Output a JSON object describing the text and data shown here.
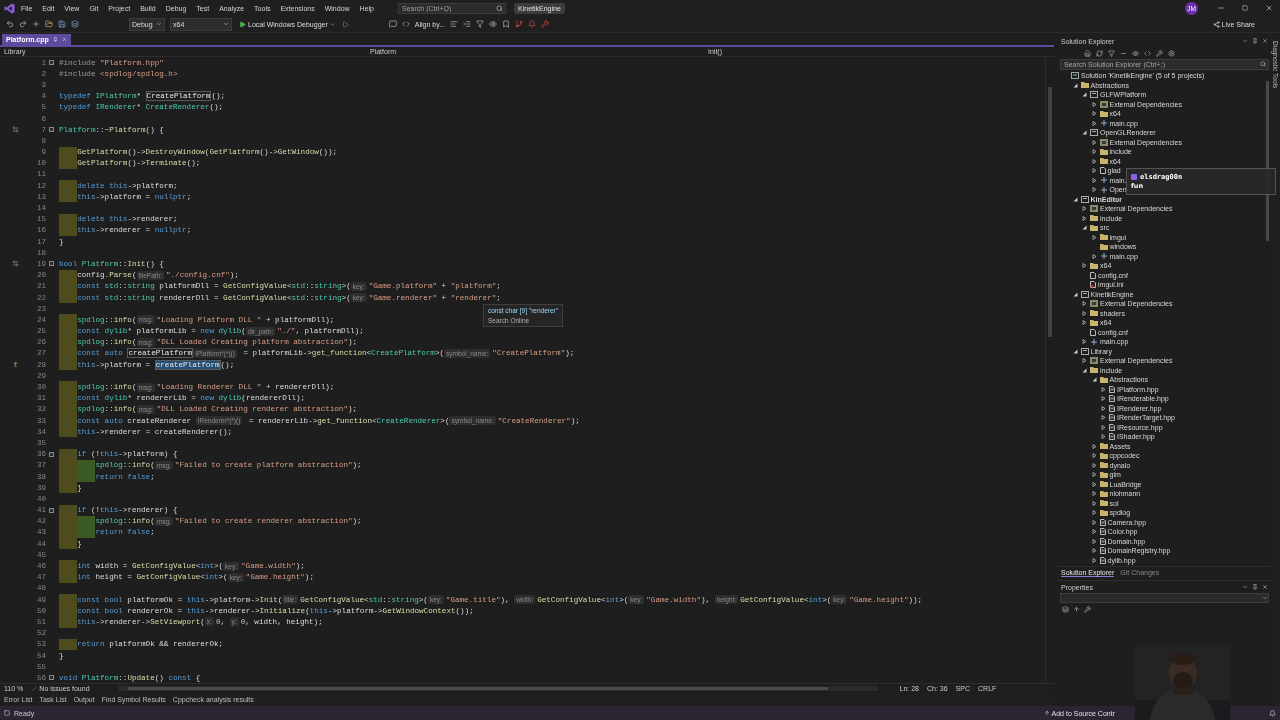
{
  "title_bar": {
    "menus": [
      "File",
      "Edit",
      "View",
      "Git",
      "Project",
      "Build",
      "Debug",
      "Test",
      "Analyze",
      "Tools",
      "Extensions",
      "Window",
      "Help"
    ],
    "search": {
      "placeholder": "Search (Ctrl+Q)"
    },
    "project": "KinetikEngine",
    "avatar": "JM"
  },
  "toolbar": {
    "configuration": "Debug",
    "platform": "x64",
    "debugger": "Local Windows Debugger",
    "align": "Align by...",
    "live_share": "Live Share"
  },
  "editor": {
    "tabs": [
      {
        "label": "Platform.cpp",
        "selected": true
      }
    ],
    "nav": {
      "project": "Library",
      "scope": "Platform",
      "member": "Init()"
    },
    "lines": [
      {
        "no": "1",
        "fold": true,
        "mark": false,
        "tokens": [
          {
            "kind": "pp",
            "text": "#include "
          },
          {
            "kind": "str",
            "text": "\"Platform.hpp\""
          }
        ]
      },
      {
        "no": "2",
        "fold": false,
        "mark": false,
        "tokens": [
          {
            "kind": "pp",
            "text": "#include "
          },
          {
            "kind": "str",
            "text": "<spdlog/spdlog.h>"
          }
        ]
      },
      {
        "no": "3",
        "fold": false,
        "mark": false
      },
      {
        "no": "4",
        "fold": false,
        "mark": false,
        "tokens": [
          {
            "kind": "kw",
            "text": "typedef "
          },
          {
            "kind": "ty",
            "text": "IPlatform"
          },
          {
            "kind": "txt",
            "text": "* "
          },
          {
            "kind": "ref",
            "text": "CreatePlatform"
          },
          {
            "kind": "txt",
            "text": "();"
          }
        ]
      },
      {
        "no": "5",
        "fold": false,
        "mark": false,
        "tokens": [
          {
            "kind": "kw",
            "text": "typedef "
          },
          {
            "kind": "ty",
            "text": "IRenderer"
          },
          {
            "kind": "txt",
            "text": "* "
          },
          {
            "kind": "ty",
            "text": "CreateRenderer"
          },
          {
            "kind": "txt",
            "text": "();"
          }
        ]
      },
      {
        "no": "6",
        "fold": false,
        "mark": false
      },
      {
        "no": "7",
        "fold": true,
        "mark": false,
        "kind": "override",
        "tokens": [
          {
            "kind": "ty",
            "text": "Platform"
          },
          {
            "kind": "txt",
            "text": "::~"
          },
          {
            "kind": "fn",
            "text": "Platform"
          },
          {
            "kind": "txt",
            "text": "() {"
          }
        ]
      },
      {
        "no": "8",
        "fold": false,
        "mark": false
      },
      {
        "no": "9",
        "fold": false,
        "mark": true,
        "tokens": [
          {
            "kind": "fn",
            "text": "    GetPlatform"
          },
          {
            "kind": "txt",
            "text": "()->"
          },
          {
            "kind": "fn",
            "text": "DestroyWindow"
          },
          {
            "kind": "txt",
            "text": "("
          },
          {
            "kind": "fn",
            "text": "GetPlatform"
          },
          {
            "kind": "txt",
            "text": "()->"
          },
          {
            "kind": "fn",
            "text": "GetWindow"
          },
          {
            "kind": "txt",
            "text": "());"
          }
        ]
      },
      {
        "no": "10",
        "fold": false,
        "mark": true,
        "tokens": [
          {
            "kind": "fn",
            "text": "    GetPlatform"
          },
          {
            "kind": "txt",
            "text": "()->"
          },
          {
            "kind": "fn",
            "text": "Terminate"
          },
          {
            "kind": "txt",
            "text": "();"
          }
        ]
      },
      {
        "no": "11",
        "fold": false,
        "mark": false
      },
      {
        "no": "12",
        "fold": false,
        "mark": true,
        "tokens": [
          {
            "kind": "kw",
            "text": "    delete this"
          },
          {
            "kind": "txt",
            "text": "->platform;"
          }
        ]
      },
      {
        "no": "13",
        "fold": false,
        "mark": true,
        "tokens": [
          {
            "kind": "kw",
            "text": "    this"
          },
          {
            "kind": "txt",
            "text": "->platform = "
          },
          {
            "kind": "kw",
            "text": "nullptr"
          },
          {
            "kind": "txt",
            "text": ";"
          }
        ]
      },
      {
        "no": "14",
        "fold": false,
        "mark": false
      },
      {
        "no": "15",
        "fold": false,
        "mark": true,
        "tokens": [
          {
            "kind": "kw",
            "text": "    delete this"
          },
          {
            "kind": "txt",
            "text": "->renderer;"
          }
        ]
      },
      {
        "no": "16",
        "fold": false,
        "mark": true,
        "tokens": [
          {
            "kind": "kw",
            "text": "    this"
          },
          {
            "kind": "txt",
            "text": "->renderer = "
          },
          {
            "kind": "kw",
            "text": "nullptr"
          },
          {
            "kind": "txt",
            "text": ";"
          }
        ]
      },
      {
        "no": "17",
        "fold": false,
        "mark": false,
        "tokens": [
          {
            "kind": "txt",
            "text": "}"
          }
        ]
      },
      {
        "no": "18",
        "fold": false,
        "mark": false
      },
      {
        "no": "19",
        "fold": true,
        "mark": false,
        "kind": "override",
        "tokens": [
          {
            "kind": "kw",
            "text": "bool "
          },
          {
            "kind": "ty",
            "text": "Platform"
          },
          {
            "kind": "txt",
            "text": "::"
          },
          {
            "kind": "fn",
            "text": "Init"
          },
          {
            "kind": "txt",
            "text": "() {"
          }
        ]
      },
      {
        "no": "20",
        "fold": false,
        "mark": true,
        "tokens": [
          {
            "kind": "txt",
            "text": "    config."
          },
          {
            "kind": "fn",
            "text": "Parse"
          },
          {
            "kind": "txt",
            "text": "("
          },
          {
            "kind": "hint",
            "text": "filePath:"
          },
          {
            "kind": "str",
            "text": "\"./config.cnf\""
          },
          {
            "kind": "txt",
            "text": ");"
          }
        ]
      },
      {
        "no": "21",
        "fold": false,
        "mark": true,
        "tokens": [
          {
            "kind": "kw",
            "text": "    const "
          },
          {
            "kind": "ty",
            "text": "std"
          },
          {
            "kind": "txt",
            "text": "::"
          },
          {
            "kind": "ty",
            "text": "string"
          },
          {
            "kind": "txt",
            "text": " platformDll = "
          },
          {
            "kind": "fn",
            "text": "GetConfigValue"
          },
          {
            "kind": "txt",
            "text": "<"
          },
          {
            "kind": "ty",
            "text": "std"
          },
          {
            "kind": "txt",
            "text": "::"
          },
          {
            "kind": "ty",
            "text": "string"
          },
          {
            "kind": "txt",
            "text": ">("
          },
          {
            "kind": "hint",
            "text": "key:"
          },
          {
            "kind": "str",
            "text": "\"Game.platform\""
          },
          {
            "kind": "txt",
            "text": " + "
          },
          {
            "kind": "str",
            "text": "\"platform\""
          },
          {
            "kind": "txt",
            "text": ";"
          }
        ]
      },
      {
        "no": "22",
        "fold": false,
        "mark": true,
        "tokens": [
          {
            "kind": "kw",
            "text": "    const "
          },
          {
            "kind": "ty",
            "text": "std"
          },
          {
            "kind": "txt",
            "text": "::"
          },
          {
            "kind": "ty",
            "text": "string"
          },
          {
            "kind": "txt",
            "text": " rendererDll = "
          },
          {
            "kind": "fn",
            "text": "GetConfigValue"
          },
          {
            "kind": "txt",
            "text": "<"
          },
          {
            "kind": "ty",
            "text": "std"
          },
          {
            "kind": "txt",
            "text": "::"
          },
          {
            "kind": "ty",
            "text": "string"
          },
          {
            "kind": "txt",
            "text": ">("
          },
          {
            "kind": "hint",
            "text": "key:"
          },
          {
            "kind": "str",
            "text": "\"Game.renderer\""
          },
          {
            "kind": "txt",
            "text": " + "
          },
          {
            "kind": "str",
            "text": "\"renderer\""
          },
          {
            "kind": "txt",
            "text": ";"
          }
        ]
      },
      {
        "no": "23",
        "fold": false,
        "mark": false
      },
      {
        "no": "24",
        "fold": false,
        "mark": true,
        "tokens": [
          {
            "kind": "ty",
            "text": "    spdlog"
          },
          {
            "kind": "txt",
            "text": "::"
          },
          {
            "kind": "fn",
            "text": "info"
          },
          {
            "kind": "txt",
            "text": "("
          },
          {
            "kind": "hint",
            "text": "msg:"
          },
          {
            "kind": "str",
            "text": "\"Loading Platform DLL \""
          },
          {
            "kind": "txt",
            "text": " + platformDll);"
          }
        ]
      },
      {
        "no": "25",
        "fold": false,
        "mark": true,
        "tokens": [
          {
            "kind": "kw",
            "text": "    const "
          },
          {
            "kind": "ty",
            "text": "dylib"
          },
          {
            "kind": "txt",
            "text": "* platformLib = "
          },
          {
            "kind": "kw",
            "text": "new "
          },
          {
            "kind": "ty",
            "text": "dylib"
          },
          {
            "kind": "txt",
            "text": "("
          },
          {
            "kind": "hint",
            "text": "dir_path:"
          },
          {
            "kind": "str",
            "text": "\"./\""
          },
          {
            "kind": "txt",
            "text": ", platformDll);"
          }
        ]
      },
      {
        "no": "26",
        "fold": false,
        "mark": true,
        "tokens": [
          {
            "kind": "ty",
            "text": "    spdlog"
          },
          {
            "kind": "txt",
            "text": "::"
          },
          {
            "kind": "fn",
            "text": "info"
          },
          {
            "kind": "txt",
            "text": "("
          },
          {
            "kind": "hint",
            "text": "msg:"
          },
          {
            "kind": "str",
            "text": "\"DLL Loaded Creating platform abstraction\""
          },
          {
            "kind": "txt",
            "text": ");"
          }
        ]
      },
      {
        "no": "27",
        "fold": false,
        "mark": true,
        "tokens": [
          {
            "kind": "kw",
            "text": "    const auto "
          },
          {
            "kind": "ref",
            "text": "createPlatform"
          },
          {
            "kind": "hint",
            "text": "IPlatform*(*)()"
          },
          {
            "kind": "txt",
            "text": " = platformLib->"
          },
          {
            "kind": "fn",
            "text": "get_function"
          },
          {
            "kind": "txt",
            "text": "<"
          },
          {
            "kind": "ty",
            "text": "CreatePlatform"
          },
          {
            "kind": "txt",
            "text": ">("
          },
          {
            "kind": "hint",
            "text": "symbol_name:"
          },
          {
            "kind": "str",
            "text": "\"CreatePlatform\""
          },
          {
            "kind": "txt",
            "text": ");"
          }
        ]
      },
      {
        "no": "28",
        "fold": false,
        "mark": true,
        "kind": "marker",
        "tokens": [
          {
            "kind": "kw",
            "text": "    this"
          },
          {
            "kind": "txt",
            "text": "->platform = "
          },
          {
            "kind": "sel",
            "text": "createPlatform"
          },
          {
            "kind": "txt",
            "text": "();"
          }
        ]
      },
      {
        "no": "29",
        "fold": false,
        "mark": false
      },
      {
        "no": "30",
        "fold": false,
        "mark": true,
        "tokens": [
          {
            "kind": "ty",
            "text": "    spdlog"
          },
          {
            "kind": "txt",
            "text": "::"
          },
          {
            "kind": "fn",
            "text": "info"
          },
          {
            "kind": "txt",
            "text": "("
          },
          {
            "kind": "hint",
            "text": "msg:"
          },
          {
            "kind": "str",
            "text": "\"Loading Renderer DLL \""
          },
          {
            "kind": "txt",
            "text": " + rendererDll);"
          }
        ]
      },
      {
        "no": "31",
        "fold": false,
        "mark": true,
        "tokens": [
          {
            "kind": "kw",
            "text": "    const "
          },
          {
            "kind": "ty",
            "text": "dylib"
          },
          {
            "kind": "txt",
            "text": "* rendererLib = "
          },
          {
            "kind": "kw",
            "text": "new "
          },
          {
            "kind": "ty",
            "text": "dylib"
          },
          {
            "kind": "txt",
            "text": "(rendererDll);"
          }
        ]
      },
      {
        "no": "32",
        "fold": false,
        "mark": true,
        "tokens": [
          {
            "kind": "ty",
            "text": "    spdlog"
          },
          {
            "kind": "txt",
            "text": "::"
          },
          {
            "kind": "fn",
            "text": "info"
          },
          {
            "kind": "txt",
            "text": "("
          },
          {
            "kind": "hint",
            "text": "msg:"
          },
          {
            "kind": "str",
            "text": "\"DLL Loaded Creating renderer abstraction\""
          },
          {
            "kind": "txt",
            "text": ");"
          }
        ]
      },
      {
        "no": "33",
        "fold": false,
        "mark": true,
        "tokens": [
          {
            "kind": "kw",
            "text": "    const auto"
          },
          {
            "kind": "txt",
            "text": " createRenderer "
          },
          {
            "kind": "hint",
            "text": "IRenderer*(*)()"
          },
          {
            "kind": "txt",
            "text": " = rendererLib->"
          },
          {
            "kind": "fn",
            "text": "get_function"
          },
          {
            "kind": "txt",
            "text": "<"
          },
          {
            "kind": "ty",
            "text": "CreateRenderer"
          },
          {
            "kind": "txt",
            "text": ">("
          },
          {
            "kind": "hint",
            "text": "symbol_name:"
          },
          {
            "kind": "str",
            "text": "\"CreateRenderer\""
          },
          {
            "kind": "txt",
            "text": ");"
          }
        ]
      },
      {
        "no": "34",
        "fold": false,
        "mark": true,
        "tokens": [
          {
            "kind": "kw",
            "text": "    this"
          },
          {
            "kind": "txt",
            "text": "->renderer = createRenderer();"
          }
        ]
      },
      {
        "no": "35",
        "fold": false,
        "mark": false
      },
      {
        "no": "36",
        "fold": true,
        "mark": true,
        "tokens": [
          {
            "kind": "kw",
            "text": "    if"
          },
          {
            "kind": "txt",
            "text": " (!"
          },
          {
            "kind": "kw",
            "text": "this"
          },
          {
            "kind": "txt",
            "text": "->platform) {"
          }
        ]
      },
      {
        "no": "37",
        "fold": false,
        "mark": true,
        "tokens": [
          {
            "kind": "ty",
            "text": "        spdlog"
          },
          {
            "kind": "txt",
            "text": "::"
          },
          {
            "kind": "fn",
            "text": "info"
          },
          {
            "kind": "txt",
            "text": "("
          },
          {
            "kind": "hint",
            "text": "msg:"
          },
          {
            "kind": "str",
            "text": "\"Failed to create platform abstraction\""
          },
          {
            "kind": "txt",
            "text": ");"
          }
        ]
      },
      {
        "no": "38",
        "fold": false,
        "mark": true,
        "tokens": [
          {
            "kind": "kw",
            "text": "        return false"
          },
          {
            "kind": "txt",
            "text": ";"
          }
        ]
      },
      {
        "no": "39",
        "fold": false,
        "mark": true,
        "tokens": [
          {
            "kind": "txt",
            "text": "    }"
          }
        ]
      },
      {
        "no": "40",
        "fold": false,
        "mark": false
      },
      {
        "no": "41",
        "fold": true,
        "mark": true,
        "tokens": [
          {
            "kind": "kw",
            "text": "    if"
          },
          {
            "kind": "txt",
            "text": " (!"
          },
          {
            "kind": "kw",
            "text": "this"
          },
          {
            "kind": "txt",
            "text": "->renderer) {"
          }
        ]
      },
      {
        "no": "42",
        "fold": false,
        "mark": true,
        "tokens": [
          {
            "kind": "ty",
            "text": "        spdlog"
          },
          {
            "kind": "txt",
            "text": "::"
          },
          {
            "kind": "fn",
            "text": "info"
          },
          {
            "kind": "txt",
            "text": "("
          },
          {
            "kind": "hint",
            "text": "msg:"
          },
          {
            "kind": "str",
            "text": "\"Failed to create renderer abstraction\""
          },
          {
            "kind": "txt",
            "text": ");"
          }
        ]
      },
      {
        "no": "43",
        "fold": false,
        "mark": true,
        "tokens": [
          {
            "kind": "kw",
            "text": "        return false"
          },
          {
            "kind": "txt",
            "text": ";"
          }
        ]
      },
      {
        "no": "44",
        "fold": false,
        "mark": true,
        "tokens": [
          {
            "kind": "txt",
            "text": "    }"
          }
        ]
      },
      {
        "no": "45",
        "fold": false,
        "mark": false
      },
      {
        "no": "46",
        "fold": false,
        "mark": true,
        "tokens": [
          {
            "kind": "kw",
            "text": "    int"
          },
          {
            "kind": "txt",
            "text": " width = "
          },
          {
            "kind": "fn",
            "text": "GetConfigValue"
          },
          {
            "kind": "txt",
            "text": "<"
          },
          {
            "kind": "kw",
            "text": "int"
          },
          {
            "kind": "txt",
            "text": ">("
          },
          {
            "kind": "hint",
            "text": "key:"
          },
          {
            "kind": "str",
            "text": "\"Game.width\""
          },
          {
            "kind": "txt",
            "text": ");"
          }
        ]
      },
      {
        "no": "47",
        "fold": false,
        "mark": true,
        "tokens": [
          {
            "kind": "kw",
            "text": "    int"
          },
          {
            "kind": "txt",
            "text": " height = "
          },
          {
            "kind": "fn",
            "text": "GetConfigValue"
          },
          {
            "kind": "txt",
            "text": "<"
          },
          {
            "kind": "kw",
            "text": "int"
          },
          {
            "kind": "txt",
            "text": ">("
          },
          {
            "kind": "hint",
            "text": "key:"
          },
          {
            "kind": "str",
            "text": "\"Game.height\""
          },
          {
            "kind": "txt",
            "text": ");"
          }
        ]
      },
      {
        "no": "48",
        "fold": false,
        "mark": false
      },
      {
        "no": "49",
        "fold": false,
        "mark": true,
        "tokens": [
          {
            "kind": "kw",
            "text": "    const bool"
          },
          {
            "kind": "txt",
            "text": " platformOk = "
          },
          {
            "kind": "kw",
            "text": "this"
          },
          {
            "kind": "txt",
            "text": "->platform->"
          },
          {
            "kind": "fn",
            "text": "Init"
          },
          {
            "kind": "txt",
            "text": "("
          },
          {
            "kind": "hint",
            "text": "title:"
          },
          {
            "kind": "fn",
            "text": "GetConfigValue"
          },
          {
            "kind": "txt",
            "text": "<"
          },
          {
            "kind": "ty",
            "text": "std"
          },
          {
            "kind": "txt",
            "text": "::"
          },
          {
            "kind": "ty",
            "text": "string"
          },
          {
            "kind": "txt",
            "text": ">("
          },
          {
            "kind": "hint",
            "text": "key:"
          },
          {
            "kind": "str",
            "text": "\"Game.title\""
          },
          {
            "kind": "txt",
            "text": "), "
          },
          {
            "kind": "hint",
            "text": "width:"
          },
          {
            "kind": "fn",
            "text": "GetConfigValue"
          },
          {
            "kind": "txt",
            "text": "<"
          },
          {
            "kind": "kw",
            "text": "int"
          },
          {
            "kind": "txt",
            "text": ">("
          },
          {
            "kind": "hint",
            "text": "key:"
          },
          {
            "kind": "str",
            "text": "\"Game.width\""
          },
          {
            "kind": "txt",
            "text": "), "
          },
          {
            "kind": "hint",
            "text": "height:"
          },
          {
            "kind": "fn",
            "text": "GetConfigValue"
          },
          {
            "kind": "txt",
            "text": "<"
          },
          {
            "kind": "kw",
            "text": "int"
          },
          {
            "kind": "txt",
            "text": ">("
          },
          {
            "kind": "hint",
            "text": "key:"
          },
          {
            "kind": "str",
            "text": "\"Game.height\""
          },
          {
            "kind": "txt",
            "text": "));"
          }
        ]
      },
      {
        "no": "50",
        "fold": false,
        "mark": true,
        "tokens": [
          {
            "kind": "kw",
            "text": "    const bool"
          },
          {
            "kind": "txt",
            "text": " rendererOk = "
          },
          {
            "kind": "kw",
            "text": "this"
          },
          {
            "kind": "txt",
            "text": "->renderer->"
          },
          {
            "kind": "fn",
            "text": "Initialize"
          },
          {
            "kind": "txt",
            "text": "("
          },
          {
            "kind": "kw",
            "text": "this"
          },
          {
            "kind": "txt",
            "text": "->platform->"
          },
          {
            "kind": "fn",
            "text": "GetWindowContext"
          },
          {
            "kind": "txt",
            "text": "());"
          }
        ]
      },
      {
        "no": "51",
        "fold": false,
        "mark": true,
        "tokens": [
          {
            "kind": "kw",
            "text": "    this"
          },
          {
            "kind": "txt",
            "text": "->renderer->"
          },
          {
            "kind": "fn",
            "text": "SetViewport"
          },
          {
            "kind": "txt",
            "text": "("
          },
          {
            "kind": "hint",
            "text": "x:"
          },
          {
            "kind": "num",
            "text": "0"
          },
          {
            "kind": "txt",
            "text": ", "
          },
          {
            "kind": "hint",
            "text": "y:"
          },
          {
            "kind": "num",
            "text": "0"
          },
          {
            "kind": "txt",
            "text": ", width, height);"
          }
        ]
      },
      {
        "no": "52",
        "fold": false,
        "mark": false
      },
      {
        "no": "53",
        "fold": false,
        "mark": true,
        "tokens": [
          {
            "kind": "kw",
            "text": "    return"
          },
          {
            "kind": "txt",
            "text": " platformOk && rendererOk;"
          }
        ]
      },
      {
        "no": "54",
        "fold": false,
        "mark": false,
        "tokens": [
          {
            "kind": "txt",
            "text": "}"
          }
        ]
      },
      {
        "no": "55",
        "fold": false,
        "mark": false
      },
      {
        "no": "56",
        "fold": true,
        "mark": false,
        "tokens": [
          {
            "kind": "kw",
            "text": "void "
          },
          {
            "kind": "ty",
            "text": "Platform"
          },
          {
            "kind": "txt",
            "text": "::"
          },
          {
            "kind": "fn",
            "text": "Update"
          },
          {
            "kind": "txt",
            "text": "() "
          },
          {
            "kind": "kw",
            "text": "const"
          },
          {
            "kind": "txt",
            "text": " {"
          }
        ]
      }
    ],
    "quick_info": {
      "signature": "const char [9] \"renderer\"",
      "action": "Search Online"
    },
    "status": {
      "zoom": "110 %",
      "issues": "No issues found",
      "line": "Ln: 28",
      "column": "Ch: 36",
      "indent": "SPC",
      "eol": "CRLF"
    }
  },
  "solution_explorer": {
    "title": "Solution Explorer",
    "search": {
      "placeholder": "Search Solution Explorer (Ctrl+;)"
    },
    "tree": [
      {
        "label": "Solution 'KinetikEngine' (5 of 5 projects)",
        "kind": "solution",
        "children": [
          {
            "label": "Abstractions",
            "kind": "folder",
            "expanded": true,
            "children": [
              {
                "label": "GLFWPlatform",
                "kind": "project",
                "expanded": true,
                "children": [
                  {
                    "label": "External Dependencies",
                    "kind": "deps",
                    "expanded": false
                  },
                  {
                    "label": "x64",
                    "kind": "folder",
                    "expanded": false
                  },
                  {
                    "label": "main.cpp",
                    "kind": "cpp",
                    "expanded": false
                  }
                ]
              },
              {
                "label": "OpenGLRenderer",
                "kind": "project",
                "expanded": true,
                "children": [
                  {
                    "label": "External Dependencies",
                    "kind": "deps",
                    "expanded": false
                  },
                  {
                    "label": "include",
                    "kind": "folder",
                    "expanded": false
                  },
                  {
                    "label": "x64",
                    "kind": "folder",
                    "expanded": false
                  },
                  {
                    "label": "glad",
                    "kind": "file",
                    "expanded": false
                  },
                  {
                    "label": "main.",
                    "kind": "cpp",
                    "expanded": false
                  },
                  {
                    "label": "Open",
                    "kind": "cpp",
                    "expanded": false
                  }
                ]
              }
            ]
          },
          {
            "label": "KinEditor",
            "kind": "project",
            "expanded": true,
            "children": [
              {
                "label": "External Dependencies",
                "kind": "deps",
                "expanded": false
              },
              {
                "label": "include",
                "kind": "folder",
                "expanded": false
              },
              {
                "label": "src",
                "kind": "folder",
                "expanded": true,
                "children": [
                  {
                    "label": "imgui",
                    "kind": "folder",
                    "expanded": false
                  },
                  {
                    "label": "windows",
                    "kind": "folder"
                  },
                  {
                    "label": "main.cpp",
                    "kind": "cpp",
                    "expanded": false
                  }
                ]
              },
              {
                "label": "x64",
                "kind": "folder",
                "expanded": false
              },
              {
                "label": "config.cnf",
                "kind": "file"
              },
              {
                "label": "imgui.ini",
                "kind": "ini"
              }
            ]
          },
          {
            "label": "KinetikEngine",
            "kind": "project",
            "expanded": true,
            "children": [
              {
                "label": "External Dependencies",
                "kind": "deps",
                "expanded": false
              },
              {
                "label": "shaders",
                "kind": "folder",
                "expanded": false
              },
              {
                "label": "x64",
                "kind": "folder",
                "expanded": false
              },
              {
                "label": "config.cnf",
                "kind": "file"
              },
              {
                "label": "main.cpp",
                "kind": "cpp",
                "expanded": false
              }
            ]
          },
          {
            "label": "Library",
            "kind": "project",
            "expanded": true,
            "children": [
              {
                "label": "External Dependencies",
                "kind": "deps",
                "expanded": false
              },
              {
                "label": "include",
                "kind": "folder",
                "expanded": true,
                "children": [
                  {
                    "label": "Abstractions",
                    "kind": "folder",
                    "expanded": true,
                    "children": [
                      {
                        "label": "IPlatform.hpp",
                        "kind": "header",
                        "expanded": false
                      },
                      {
                        "label": "IRenderable.hpp",
                        "kind": "header",
                        "expanded": false
                      },
                      {
                        "label": "IRenderer.hpp",
                        "kind": "header",
                        "expanded": false
                      },
                      {
                        "label": "IRenderTarget.hpp",
                        "kind": "header",
                        "expanded": false
                      },
                      {
                        "label": "IResource.hpp",
                        "kind": "header",
                        "expanded": false
                      },
                      {
                        "label": "IShader.hpp",
                        "kind": "header",
                        "expanded": false
                      }
                    ]
                  },
                  {
                    "label": "Assets",
                    "kind": "folder",
                    "expanded": false
                  },
                  {
                    "label": "cppcodec",
                    "kind": "folder",
                    "expanded": false
                  },
                  {
                    "label": "dynalo",
                    "kind": "folder",
                    "expanded": false
                  },
                  {
                    "label": "glm",
                    "kind": "folder",
                    "expanded": false
                  },
                  {
                    "label": "LuaBridge",
                    "kind": "folder",
                    "expanded": false
                  },
                  {
                    "label": "nlohmann",
                    "kind": "folder",
                    "expanded": false
                  },
                  {
                    "label": "sol",
                    "kind": "folder",
                    "expanded": false
                  },
                  {
                    "label": "spdlog",
                    "kind": "folder",
                    "expanded": false
                  },
                  {
                    "label": "Camera.hpp",
                    "kind": "header",
                    "expanded": false
                  },
                  {
                    "label": "Color.hpp",
                    "kind": "header",
                    "expanded": false
                  },
                  {
                    "label": "Domain.hpp",
                    "kind": "header",
                    "expanded": false
                  },
                  {
                    "label": "DomainRegistry.hpp",
                    "kind": "header",
                    "expanded": false
                  },
                  {
                    "label": "dylib.hpp",
                    "kind": "header",
                    "expanded": false
                  }
                ]
              }
            ]
          }
        ]
      }
    ],
    "tabs": [
      {
        "label": "Solution Explorer",
        "selected": true
      },
      {
        "label": "Git Changes",
        "selected": false
      }
    ]
  },
  "chat_overlay": {
    "user": "elsdrag00n",
    "message": "fun"
  },
  "properties": {
    "title": "Properties"
  },
  "side_strip": "Diagnostic Tools",
  "bottom_tabs": [
    "Error List",
    "Task List",
    "Output",
    "Find Symbol Results",
    "Cppcheck analysis results"
  ],
  "status_bar": {
    "state": "Ready",
    "source_control": "Add to Source Contr"
  },
  "webcam": {
    "kind": "picture"
  }
}
